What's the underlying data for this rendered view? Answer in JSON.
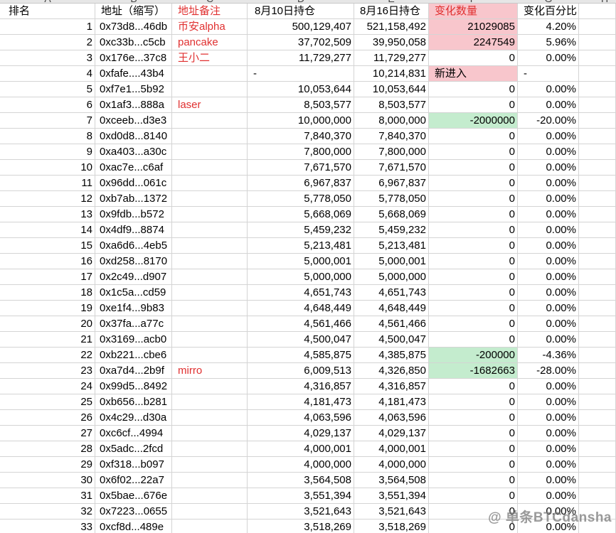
{
  "column_letters": [
    "A",
    "B",
    "C",
    "D",
    "E",
    "F",
    "G",
    "H"
  ],
  "headers": {
    "rank": "排名",
    "address": "地址（缩写）",
    "note": "地址备注",
    "aug10": "8月10日持仓",
    "aug16": "8月16日持仓",
    "change": "变化数量",
    "percent": "变化百分比"
  },
  "rows": [
    {
      "rank": "1",
      "address": "0x73d8...46db",
      "note": "币安alpha",
      "aug10": "500,129,407",
      "aug16": "521,158,492",
      "change": "21029085",
      "percent": "4.20%",
      "highlight": "pink"
    },
    {
      "rank": "2",
      "address": "0xc33b...c5cb",
      "note": "pancake",
      "aug10": "37,702,509",
      "aug16": "39,950,058",
      "change": "2247549",
      "percent": "5.96%",
      "highlight": "pink"
    },
    {
      "rank": "3",
      "address": "0x176e...37c8",
      "note": "王小二",
      "aug10": "11,729,277",
      "aug16": "11,729,277",
      "change": "0",
      "percent": "0.00%",
      "highlight": ""
    },
    {
      "rank": "4",
      "address": "0xfafe....43b4",
      "note": "",
      "aug10": "-",
      "aug16": "10,214,831",
      "change": "新进入",
      "percent": "-",
      "highlight": "pink-text"
    },
    {
      "rank": "5",
      "address": "0xf7e1...5b92",
      "note": "",
      "aug10": "10,053,644",
      "aug16": "10,053,644",
      "change": "0",
      "percent": "0.00%",
      "highlight": ""
    },
    {
      "rank": "6",
      "address": "0x1af3...888a",
      "note": "laser",
      "aug10": "8,503,577",
      "aug16": "8,503,577",
      "change": "0",
      "percent": "0.00%",
      "highlight": ""
    },
    {
      "rank": "7",
      "address": "0xceeb...d3e3",
      "note": "",
      "aug10": "10,000,000",
      "aug16": "8,000,000",
      "change": "-2000000",
      "percent": "-20.00%",
      "highlight": "green"
    },
    {
      "rank": "8",
      "address": "0xd0d8...8140",
      "note": "",
      "aug10": "7,840,370",
      "aug16": "7,840,370",
      "change": "0",
      "percent": "0.00%",
      "highlight": ""
    },
    {
      "rank": "9",
      "address": "0xa403...a30c",
      "note": "",
      "aug10": "7,800,000",
      "aug16": "7,800,000",
      "change": "0",
      "percent": "0.00%",
      "highlight": ""
    },
    {
      "rank": "10",
      "address": "0xac7e...c6af",
      "note": "",
      "aug10": "7,671,570",
      "aug16": "7,671,570",
      "change": "0",
      "percent": "0.00%",
      "highlight": ""
    },
    {
      "rank": "11",
      "address": "0x96dd...061c",
      "note": "",
      "aug10": "6,967,837",
      "aug16": "6,967,837",
      "change": "0",
      "percent": "0.00%",
      "highlight": ""
    },
    {
      "rank": "12",
      "address": "0xb7ab...1372",
      "note": "",
      "aug10": "5,778,050",
      "aug16": "5,778,050",
      "change": "0",
      "percent": "0.00%",
      "highlight": ""
    },
    {
      "rank": "13",
      "address": "0x9fdb...b572",
      "note": "",
      "aug10": "5,668,069",
      "aug16": "5,668,069",
      "change": "0",
      "percent": "0.00%",
      "highlight": ""
    },
    {
      "rank": "14",
      "address": "0x4df9...8874",
      "note": "",
      "aug10": "5,459,232",
      "aug16": "5,459,232",
      "change": "0",
      "percent": "0.00%",
      "highlight": ""
    },
    {
      "rank": "15",
      "address": "0xa6d6...4eb5",
      "note": "",
      "aug10": "5,213,481",
      "aug16": "5,213,481",
      "change": "0",
      "percent": "0.00%",
      "highlight": ""
    },
    {
      "rank": "16",
      "address": "0xd258...8170",
      "note": "",
      "aug10": "5,000,001",
      "aug16": "5,000,001",
      "change": "0",
      "percent": "0.00%",
      "highlight": ""
    },
    {
      "rank": "17",
      "address": "0x2c49...d907",
      "note": "",
      "aug10": "5,000,000",
      "aug16": "5,000,000",
      "change": "0",
      "percent": "0.00%",
      "highlight": ""
    },
    {
      "rank": "18",
      "address": "0x1c5a...cd59",
      "note": "",
      "aug10": "4,651,743",
      "aug16": "4,651,743",
      "change": "0",
      "percent": "0.00%",
      "highlight": ""
    },
    {
      "rank": "19",
      "address": "0xe1f4...9b83",
      "note": "",
      "aug10": "4,648,449",
      "aug16": "4,648,449",
      "change": "0",
      "percent": "0.00%",
      "highlight": ""
    },
    {
      "rank": "20",
      "address": "0x37fa...a77c",
      "note": "",
      "aug10": "4,561,466",
      "aug16": "4,561,466",
      "change": "0",
      "percent": "0.00%",
      "highlight": ""
    },
    {
      "rank": "21",
      "address": "0x3169...acb0",
      "note": "",
      "aug10": "4,500,047",
      "aug16": "4,500,047",
      "change": "0",
      "percent": "0.00%",
      "highlight": ""
    },
    {
      "rank": "22",
      "address": "0xb221...cbe6",
      "note": "",
      "aug10": "4,585,875",
      "aug16": "4,385,875",
      "change": "-200000",
      "percent": "-4.36%",
      "highlight": "green"
    },
    {
      "rank": "23",
      "address": "0xa7d4...2b9f",
      "note": "mirro",
      "aug10": "6,009,513",
      "aug16": "4,326,850",
      "change": "-1682663",
      "percent": "-28.00%",
      "highlight": "green"
    },
    {
      "rank": "24",
      "address": "0x99d5...8492",
      "note": "",
      "aug10": "4,316,857",
      "aug16": "4,316,857",
      "change": "0",
      "percent": "0.00%",
      "highlight": ""
    },
    {
      "rank": "25",
      "address": "0xb656...b281",
      "note": "",
      "aug10": "4,181,473",
      "aug16": "4,181,473",
      "change": "0",
      "percent": "0.00%",
      "highlight": ""
    },
    {
      "rank": "26",
      "address": "0x4c29...d30a",
      "note": "",
      "aug10": "4,063,596",
      "aug16": "4,063,596",
      "change": "0",
      "percent": "0.00%",
      "highlight": ""
    },
    {
      "rank": "27",
      "address": "0xc6cf...4994",
      "note": "",
      "aug10": "4,029,137",
      "aug16": "4,029,137",
      "change": "0",
      "percent": "0.00%",
      "highlight": ""
    },
    {
      "rank": "28",
      "address": "0x5adc...2fcd",
      "note": "",
      "aug10": "4,000,001",
      "aug16": "4,000,001",
      "change": "0",
      "percent": "0.00%",
      "highlight": ""
    },
    {
      "rank": "29",
      "address": "0xf318...b097",
      "note": "",
      "aug10": "4,000,000",
      "aug16": "4,000,000",
      "change": "0",
      "percent": "0.00%",
      "highlight": ""
    },
    {
      "rank": "30",
      "address": "0x6f02...22a7",
      "note": "",
      "aug10": "3,564,508",
      "aug16": "3,564,508",
      "change": "0",
      "percent": "0.00%",
      "highlight": ""
    },
    {
      "rank": "31",
      "address": "0x5bae...676e",
      "note": "",
      "aug10": "3,551,394",
      "aug16": "3,551,394",
      "change": "0",
      "percent": "0.00%",
      "highlight": ""
    },
    {
      "rank": "32",
      "address": "0x7223...0655",
      "note": "",
      "aug10": "3,521,643",
      "aug16": "3,521,643",
      "change": "0",
      "percent": "0.00%",
      "highlight": ""
    },
    {
      "rank": "33",
      "address": "0xcf8d...489e",
      "note": "",
      "aug10": "3,518,269",
      "aug16": "3,518,269",
      "change": "0",
      "percent": "0.00%",
      "highlight": ""
    }
  ],
  "colors": {
    "increase_fill": "#f8c6cc",
    "decrease_fill": "#c4ecce",
    "note_text": "#e03030"
  },
  "watermark": {
    "icon": "weibo-icon",
    "text": "@ 单条BTCdansha"
  }
}
